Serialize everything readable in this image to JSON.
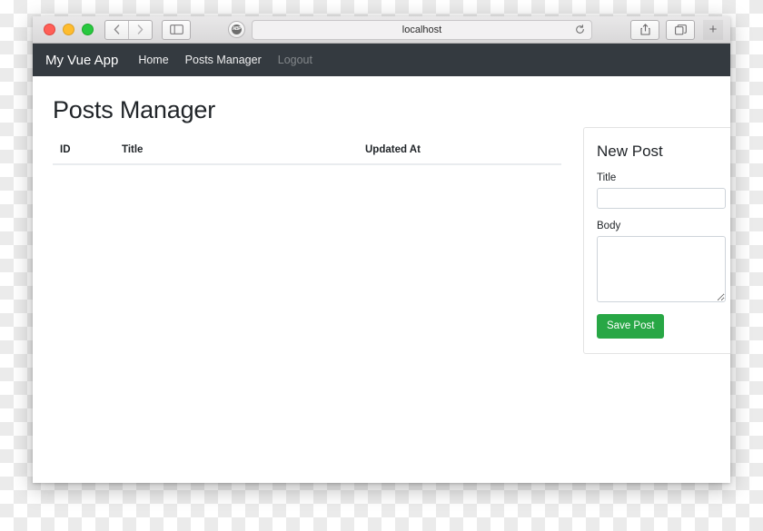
{
  "browser": {
    "window_controls": [
      {
        "name": "close",
        "color": "#ff5f57"
      },
      {
        "name": "minimize",
        "color": "#febc2e"
      },
      {
        "name": "zoom",
        "color": "#28c840"
      }
    ],
    "back_label": "‹",
    "forward_label": "›",
    "sidebar_label": "sidebar-toggle",
    "shield_label": "ABP",
    "url": "localhost",
    "reload_label": "↻",
    "share_label": "share",
    "tabs_label": "tabs",
    "newtab_label": "+"
  },
  "navbar": {
    "brand": "My Vue App",
    "links": [
      {
        "label": "Home",
        "muted": false
      },
      {
        "label": "Posts Manager",
        "muted": false
      },
      {
        "label": "Logout",
        "muted": true
      }
    ]
  },
  "page": {
    "title": "Posts Manager"
  },
  "table": {
    "headers": [
      "ID",
      "Title",
      "Updated At"
    ],
    "rows": []
  },
  "new_post": {
    "card_title": "New Post",
    "title_label": "Title",
    "title_value": "",
    "title_placeholder": "",
    "body_label": "Body",
    "body_value": "",
    "body_placeholder": "",
    "save_label": "Save Post",
    "save_color": "#28a745"
  }
}
